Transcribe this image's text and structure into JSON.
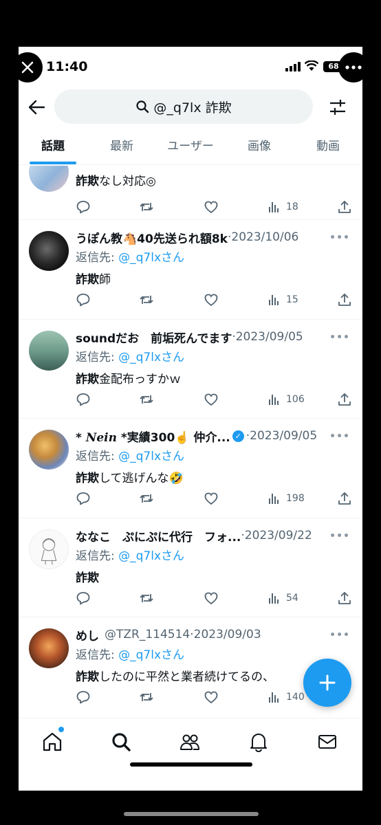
{
  "status": {
    "time": "11:40",
    "battery": "68"
  },
  "search": {
    "query": "@_q7lx 詐欺"
  },
  "tabs": [
    {
      "label": "話題",
      "active": true
    },
    {
      "label": "最新",
      "active": false
    },
    {
      "label": "ユーザー",
      "active": false
    },
    {
      "label": "画像",
      "active": false
    },
    {
      "label": "動画",
      "active": false
    }
  ],
  "tweets": [
    {
      "kw": "詐欺",
      "rest": "なし対応◎",
      "views": "18"
    },
    {
      "name": "うぽん教🐴40先送られ額8k",
      "date": "2023/10/06",
      "reply_label": "返信先:",
      "reply_to": "@_q7lxさん",
      "kw": "詐欺",
      "rest": "師",
      "views": "15"
    },
    {
      "name": "soundだお　前垢死んでます",
      "date": "2023/09/05",
      "reply_label": "返信先:",
      "reply_to": "@_q7lxさん",
      "kw": "詐欺",
      "rest": "金配布っすかｗ",
      "views": "106"
    },
    {
      "name_prefix": "* ",
      "name_styled": "Nein",
      "name": " *実績300☝️ 仲介...",
      "date": "2023/09/05",
      "reply_label": "返信先:",
      "reply_to": "@_q7lxさん",
      "kw": "詐欺",
      "rest": "して逃げんな🤣",
      "views": "198"
    },
    {
      "name": "ななこ　ぷにぷに代行　フォ...",
      "date": "2023/09/22",
      "reply_label": "返信先:",
      "reply_to": "@_q7lxさん",
      "kw": "詐欺",
      "rest": "",
      "views": "54"
    },
    {
      "name": "めし",
      "handle": "@TZR_114514",
      "date": "2023/09/03",
      "reply_label": "返信先:",
      "reply_to": "@_q7lxさん",
      "kw": "詐欺",
      "rest": "したのに平然と業者続けてるの、",
      "views": "140"
    }
  ],
  "colors": {
    "accent": "#1d9bf0",
    "text": "#0f1419",
    "muted": "#536471"
  },
  "icons": [
    "close-icon",
    "more-icon",
    "back-arrow-icon",
    "search-icon",
    "filter-icon",
    "reply-icon",
    "retweet-icon",
    "like-icon",
    "views-icon",
    "share-icon",
    "compose-icon",
    "home-icon",
    "communities-icon",
    "notifications-icon",
    "messages-icon"
  ]
}
